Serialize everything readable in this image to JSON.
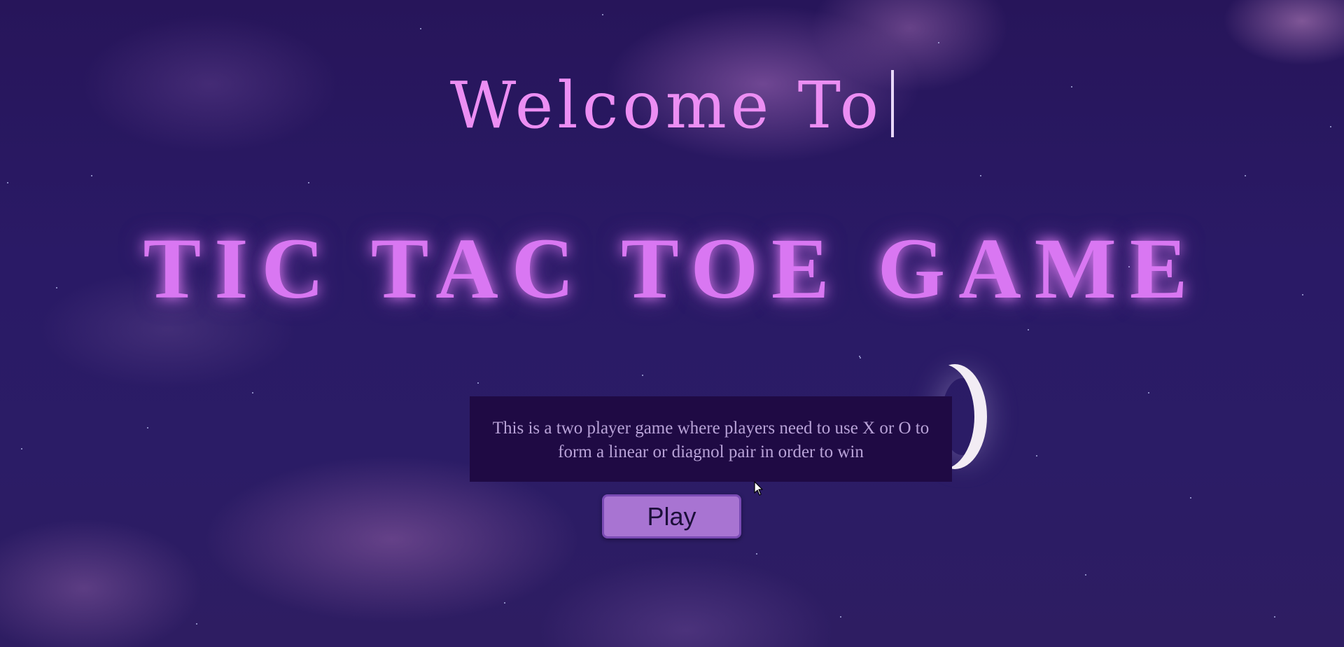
{
  "header": {
    "welcome_text": "Welcome To"
  },
  "main": {
    "title": "TIC TAC TOE GAME",
    "description_line1": "This is a two player game where players need to use X or O to",
    "description_line2": "form a linear or diagnol pair in order to win",
    "play_label": "Play"
  },
  "colors": {
    "welcome": "#ec8ef3",
    "title": "#d977f2",
    "description_bg": "#1f0a44",
    "button_bg": "#a874d2"
  },
  "icons": {
    "pointer": "mouse-pointer-icon",
    "moon": "crescent-moon-icon"
  }
}
